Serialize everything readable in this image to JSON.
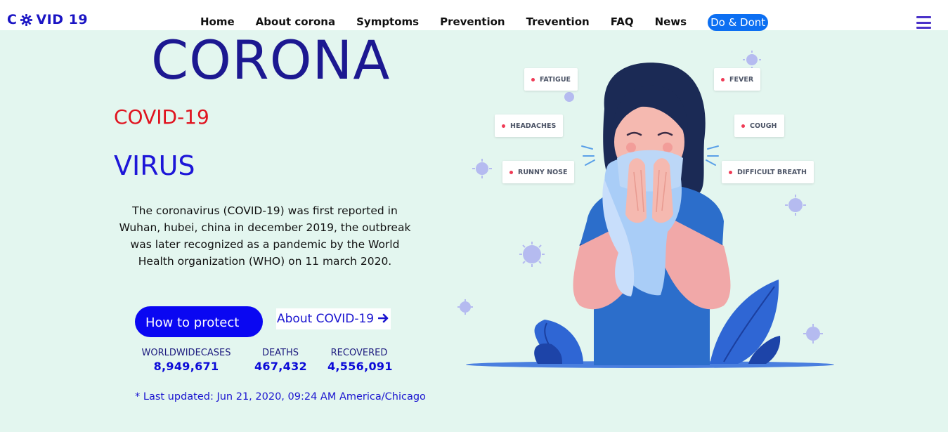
{
  "nav": {
    "logo_left": "C",
    "logo_right": "VID 19",
    "links": [
      "Home",
      "About corona",
      "Symptoms",
      "Prevention",
      "Trevention",
      "FAQ",
      "News"
    ],
    "cta": "Do & Dont"
  },
  "hero": {
    "title": "CORONA",
    "subtitle": "COVID-19",
    "tagline": "VIRUS",
    "description": "The coronavirus (COVID-19) was first reported in Wuhan, hubei, china in december 2019, the outbreak was later recognized as a pandemic by the World Health organization (WHO) on 11 march 2020.",
    "primary_button": "How to protect",
    "secondary_link": "About COVID-19"
  },
  "stats": [
    {
      "label": "WORLDWIDECASES",
      "value": "8,949,671"
    },
    {
      "label": "DEATHS",
      "value": "467,432"
    },
    {
      "label": "RECOVERED",
      "value": "4,556,091"
    }
  ],
  "last_updated": "* Last updated: Jun 21, 2020, 09:24 AM America/Chicago",
  "symptoms": [
    "FATIGUE",
    "FEVER",
    "HEADACHES",
    "COUGH",
    "RUNNY NOSE",
    "DIFFICULT BREATH"
  ],
  "colors": {
    "background": "#e3f6ef",
    "brand_blue": "#0a07f2",
    "title_navy": "#1c1891",
    "accent_red": "#e0131f",
    "nav_cta": "#0c6ff2"
  },
  "icons": {
    "logo_virus": "virus-gear-icon",
    "menu": "hamburger-menu-icon",
    "arrow": "arrow-right-icon"
  }
}
